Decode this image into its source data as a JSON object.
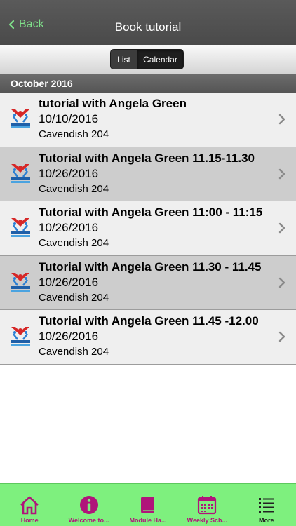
{
  "nav": {
    "back_label": "Back",
    "title": "Book tutorial"
  },
  "segments": {
    "list_label": "List",
    "calendar_label": "Calendar",
    "selected": "Calendar"
  },
  "section": {
    "title": "October 2016"
  },
  "items": [
    {
      "title": "tutorial with Angela Green",
      "date": "10/10/2016",
      "location": "Cavendish 204"
    },
    {
      "title": "Tutorial with Angela Green 11.15-11.30",
      "date": "10/26/2016",
      "location": "Cavendish 204"
    },
    {
      "title": "Tutorial with Angela Green 11:00 - 11:15",
      "date": "10/26/2016",
      "location": "Cavendish 204"
    },
    {
      "title": "Tutorial with Angela Green 11.30 - 11.45",
      "date": "10/26/2016",
      "location": "Cavendish 204"
    },
    {
      "title": "Tutorial with Angela Green 11.45 -12.00",
      "date": "10/26/2016",
      "location": "Cavendish 204"
    }
  ],
  "tabbar": {
    "tabs": [
      {
        "label": "Home",
        "icon": "home-icon"
      },
      {
        "label": "Welcome to...",
        "icon": "info-icon"
      },
      {
        "label": "Module Ha...",
        "icon": "book-icon"
      },
      {
        "label": "Weekly Sch...",
        "icon": "calendar-icon"
      },
      {
        "label": "More",
        "icon": "more-list-icon"
      }
    ]
  },
  "colors": {
    "accent_green": "#7ef07e",
    "tab_magenta": "#b0147a",
    "back_green": "#7fe08a"
  }
}
